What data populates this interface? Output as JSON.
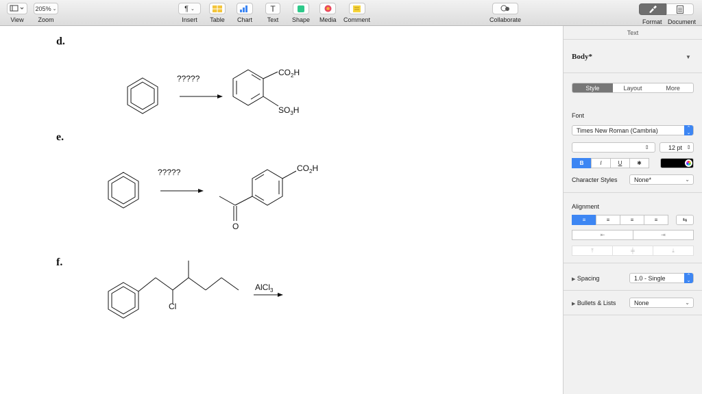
{
  "toolbar": {
    "view_label": "View",
    "zoom_value": "205%",
    "zoom_label": "Zoom",
    "insert_label": "Insert",
    "table_label": "Table",
    "chart_label": "Chart",
    "text_label": "Text",
    "shape_label": "Shape",
    "media_label": "Media",
    "comment_label": "Comment",
    "collaborate_label": "Collaborate",
    "format_label": "Format",
    "document_label": "Document"
  },
  "document": {
    "problems": [
      {
        "label": "d.",
        "reagent": "?????",
        "product_groups": [
          "CO2H",
          "SO3H"
        ]
      },
      {
        "label": "e.",
        "reagent": "?????",
        "product_groups": [
          "CO2H",
          "O"
        ]
      },
      {
        "label": "f.",
        "reagent": "AlCl3",
        "substituent": "Cl"
      }
    ]
  },
  "inspector": {
    "header": "Text",
    "paragraph_style": "Body*",
    "tabs": [
      "Style",
      "Layout",
      "More"
    ],
    "font_label": "Font",
    "font_name": "Times New Roman (Cambria)",
    "font_size": "12 pt",
    "style_buttons": [
      "B",
      "I",
      "U",
      "✱"
    ],
    "text_color": "#000000",
    "char_styles_label": "Character Styles",
    "char_styles_value": "None*",
    "alignment_label": "Alignment",
    "spacing_label": "Spacing",
    "spacing_value": "1.0 - Single",
    "bullets_label": "Bullets & Lists",
    "bullets_value": "None",
    "accent_color": "#3d86f3"
  }
}
